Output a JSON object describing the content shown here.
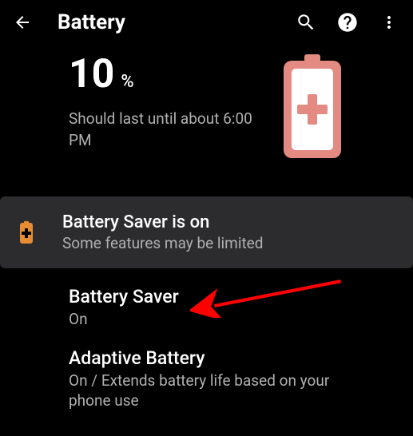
{
  "header": {
    "title": "Battery"
  },
  "summary": {
    "percent": "10",
    "percent_sign": "%",
    "estimate_line": "Should last until about 6:00 PM"
  },
  "notice": {
    "title": "Battery Saver is on",
    "subtitle": "Some features may be limited"
  },
  "items": [
    {
      "title": "Battery Saver",
      "subtitle": "On"
    },
    {
      "title": "Adaptive Battery",
      "subtitle": "On / Extends battery life based on your phone use"
    }
  ]
}
